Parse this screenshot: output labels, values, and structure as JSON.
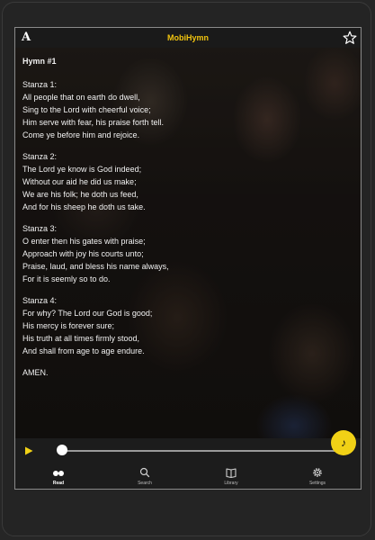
{
  "app": {
    "title": "MobiHymn",
    "accent_color": "#f1d116",
    "title_color": "#f1c40f",
    "font_button_glyph": "A",
    "font_button_icon": "font-size-icon",
    "favorite_icon": "star-outline-icon"
  },
  "hymn": {
    "title": "Hymn #1",
    "stanzas": [
      {
        "label": "Stanza 1:",
        "lines": [
          "All people that on earth do dwell,",
          "Sing to the Lord with cheerful voice;",
          "Him serve with fear, his praise forth tell.",
          "Come ye before him and rejoice."
        ]
      },
      {
        "label": "Stanza 2:",
        "lines": [
          "The Lord ye know is God indeed;",
          "Without our aid he did us make;",
          "We are his folk; he doth us feed,",
          "And for his sheep he doth us take."
        ]
      },
      {
        "label": "Stanza 3:",
        "lines": [
          "O enter then his gates with praise;",
          "Approach with joy his courts unto;",
          "Praise, laud, and bless his name always,",
          "For it is seemly so to do."
        ]
      },
      {
        "label": "Stanza 4:",
        "lines": [
          "For why? The Lord our God is good;",
          "His mercy is forever sure;",
          "His truth at all times firmly stood,",
          "And shall from age to age endure."
        ]
      }
    ],
    "closing": "AMEN."
  },
  "fab": {
    "icon": "music-note-icon",
    "glyph": "♪"
  },
  "player": {
    "play_icon": "play-icon",
    "progress": 0
  },
  "nav": {
    "items": [
      {
        "label": "Read",
        "icon": "read-glasses-icon",
        "active": true
      },
      {
        "label": "Search",
        "icon": "search-icon",
        "active": false
      },
      {
        "label": "Library",
        "icon": "book-icon",
        "active": false
      },
      {
        "label": "Settings",
        "icon": "gear-icon",
        "active": false
      }
    ]
  }
}
